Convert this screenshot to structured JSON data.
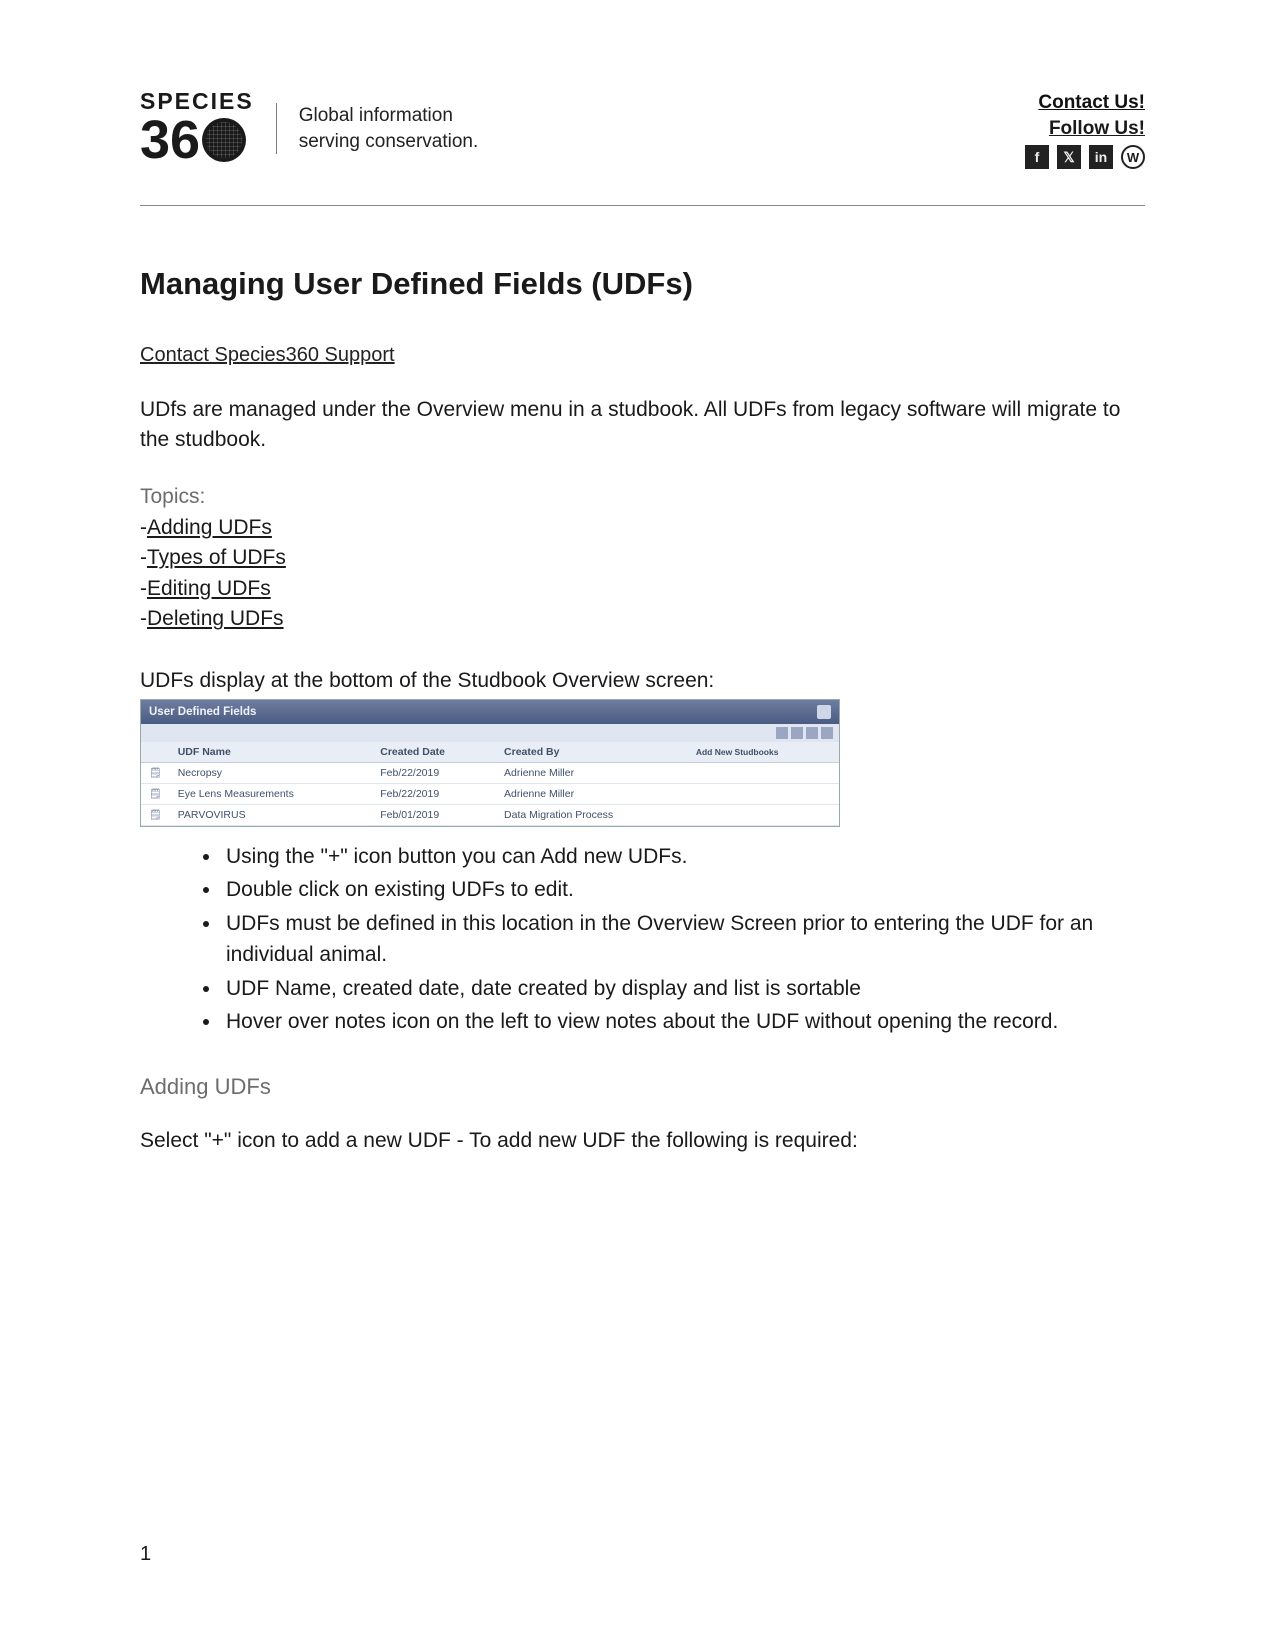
{
  "header": {
    "brand_top": "SPECIES",
    "brand_num": "36",
    "tagline_l1": "Global information",
    "tagline_l2": "serving conservation.",
    "contact_label": "Contact Us!",
    "follow_label": "Follow Us!",
    "social": [
      "f",
      "𝕏",
      "in",
      "W"
    ]
  },
  "title": "Managing User Defined Fields (UDFs)",
  "support_link": "Contact Species360 Support",
  "intro": "UDfs are managed under the Overview menu in a studbook. All UDFs from legacy software will migrate to the studbook.",
  "topics_label": "Topics:",
  "topics": [
    "Adding UDFs",
    "Types of UDFs",
    "Editing UDFs",
    "Deleting UDFs"
  ],
  "caption_above_panel": "UDFs display at the bottom of the Studbook Overview screen:",
  "panel": {
    "bar_title": "User Defined Fields",
    "columns": [
      "",
      "UDF Name",
      "Created Date",
      "Created By",
      ""
    ],
    "last_col": "Add New Studbooks",
    "rows": [
      [
        "",
        "Necropsy",
        "Feb/22/2019",
        "Adrienne Miller",
        ""
      ],
      [
        "",
        "Eye Lens Measurements",
        "Feb/22/2019",
        "Adrienne Miller",
        ""
      ],
      [
        "",
        "PARVOVIRUS",
        "Feb/01/2019",
        "Data Migration Process",
        ""
      ]
    ]
  },
  "bullets": [
    "Using the \"+\" icon button you can Add new UDFs.",
    "Double click on existing UDFs to edit.",
    "UDFs must be defined in this location in the Overview Screen prior to entering the UDF for an individual animal.",
    "UDF Name, created date, date created by display and list is sortable",
    "Hover over notes icon on the left to view notes about the UDF without opening the record."
  ],
  "section_adding": "Adding UDFs",
  "adding_body": "Select \"+\" icon to add a new UDF - To add new UDF the following is required:",
  "page_number": "1"
}
